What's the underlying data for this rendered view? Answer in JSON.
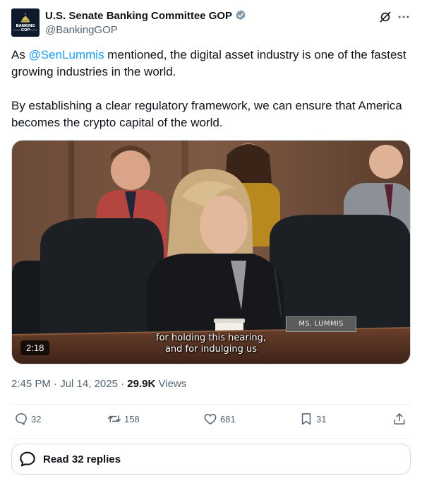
{
  "author": {
    "display_name": "U.S. Senate Banking Committee GOP",
    "handle": "@BankingGOP",
    "avatar_text": "BANKING GOP",
    "verified": true
  },
  "tweet": {
    "p1_prefix": "As ",
    "p1_mention": "@SenLummis",
    "p1_suffix": " mentioned, the digital asset industry is one of the fastest growing industries in the world.",
    "p2": "By establishing a clear regulatory framework, we can ensure that America becomes the crypto capital of the world."
  },
  "media": {
    "duration": "2:18",
    "nameplate": "MS. LUMMIS",
    "subtitle_line1": "for holding this hearing,",
    "subtitle_line2": "and for indulging us"
  },
  "meta": {
    "time": "2:45 PM",
    "separator": "·",
    "date": "Jul 14, 2025",
    "views_count": "29.9K",
    "views_label": "Views"
  },
  "actions": {
    "replies": "32",
    "reposts": "158",
    "likes": "681",
    "bookmarks": "31"
  },
  "read_replies_label": "Read 32 replies",
  "icons": {
    "verified": "verified-badge-icon",
    "grok": "grok-icon",
    "more": "more-icon",
    "reply": "reply-icon",
    "repost": "repost-icon",
    "like": "like-icon",
    "bookmark": "bookmark-icon",
    "share": "share-icon",
    "replies_bubble": "chat-bubble-icon"
  },
  "colors": {
    "accent": "#1d9bf0",
    "secondary_text": "#536471",
    "verified_badge": "#829aab"
  }
}
